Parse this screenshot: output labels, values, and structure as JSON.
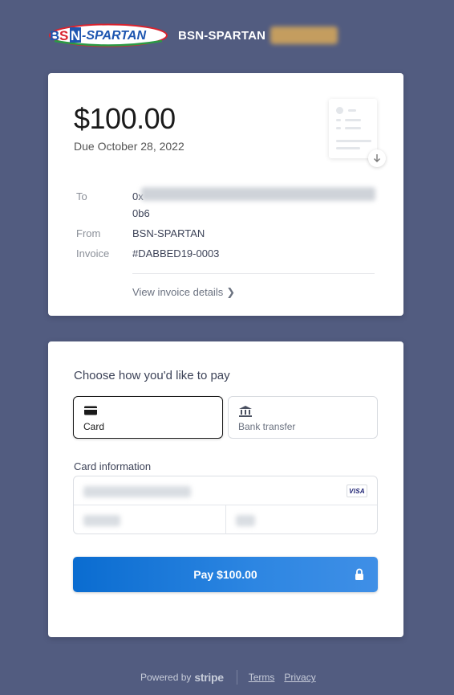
{
  "header": {
    "logo_text": "BSN-SPARTAN",
    "merchant_name": "BSN-SPARTAN"
  },
  "invoice": {
    "amount": "$100.00",
    "due": "Due October 28, 2022",
    "details": {
      "to_label": "To",
      "to_value_prefix": "0x",
      "to_value_suffix": "0b6",
      "from_label": "From",
      "from_value": "BSN-SPARTAN",
      "invoice_label": "Invoice",
      "invoice_value": "#DABBED19-0003"
    },
    "view_details_label": "View invoice details",
    "download_icon": "download-arrow-icon"
  },
  "payment": {
    "title": "Choose how you'd like to pay",
    "methods": [
      {
        "label": "Card",
        "icon": "credit-card-icon",
        "selected": true
      },
      {
        "label": "Bank transfer",
        "icon": "bank-icon",
        "selected": false
      }
    ],
    "card_info_label": "Card information",
    "card_brand": "VISA",
    "pay_button_label": "Pay $100.00"
  },
  "footer": {
    "powered_by": "Powered by",
    "brand": "stripe",
    "terms": "Terms",
    "privacy": "Privacy"
  },
  "colors": {
    "background": "#525c80",
    "pay_button": "#2d86e2",
    "logo_red": "#d9232e",
    "logo_green": "#2a9a44",
    "logo_blue": "#1e56b0"
  }
}
